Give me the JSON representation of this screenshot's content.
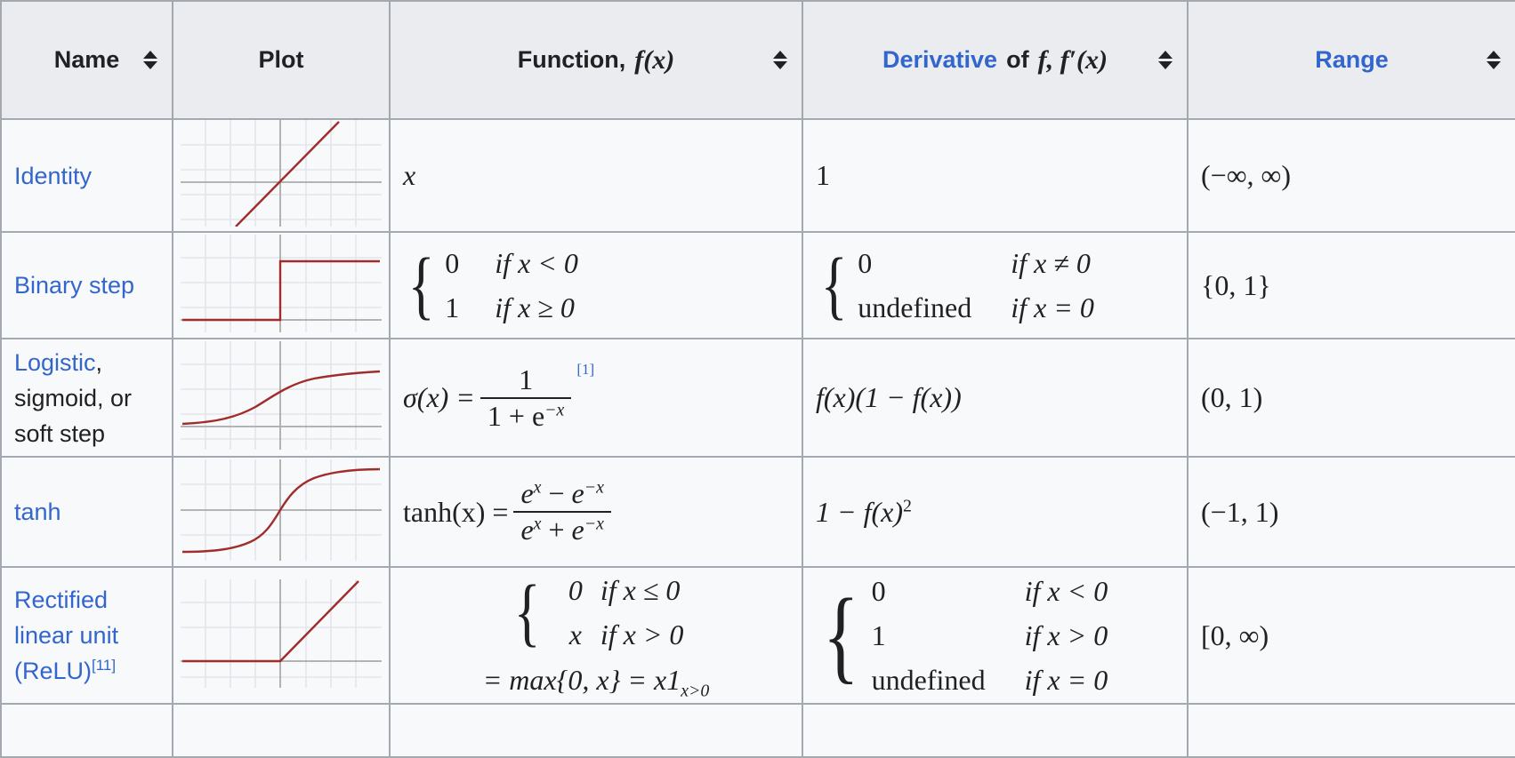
{
  "table": {
    "columns": [
      {
        "key": "name",
        "label": "Name",
        "sortable": true,
        "link": false
      },
      {
        "key": "plot",
        "label": "Plot",
        "sortable": false,
        "link": false
      },
      {
        "key": "function",
        "label": "Function, f(x)",
        "label_plain": "Function,",
        "label_math": "f(x)",
        "sortable": true,
        "link": false
      },
      {
        "key": "derivative",
        "label": "Derivative of f, f′(x)",
        "label_link": "Derivative",
        "label_plain": "of",
        "label_math": "f, f′(x)",
        "sortable": true,
        "link": true
      },
      {
        "key": "range",
        "label": "Range",
        "sortable": true,
        "link": true
      }
    ],
    "sort_icon": "sort-updown-icon",
    "rows": [
      {
        "name_parts": [
          {
            "text": "Identity",
            "link": true
          }
        ],
        "plot": "identity-plot",
        "function": {
          "kind": "simple",
          "text": "x"
        },
        "derivative": {
          "kind": "simple",
          "text": "1"
        },
        "range": "(−∞, ∞)"
      },
      {
        "name_parts": [
          {
            "text": "Binary step",
            "link": true
          }
        ],
        "plot": "binary-step-plot",
        "function": {
          "kind": "cases",
          "rows": [
            {
              "value": "0",
              "cond": "if x < 0"
            },
            {
              "value": "1",
              "cond": "if x ≥ 0"
            }
          ]
        },
        "derivative": {
          "kind": "cases",
          "rows": [
            {
              "value": "0",
              "cond": "if x ≠ 0"
            },
            {
              "value": "undefined",
              "cond": "if x = 0"
            }
          ]
        },
        "range": "{0, 1}"
      },
      {
        "name_parts": [
          {
            "text": "Logistic",
            "link": true
          },
          {
            "text": ", sigmoid, or soft step",
            "link": false
          }
        ],
        "name_lines": [
          "Logistic,",
          "sigmoid, or",
          "soft step"
        ],
        "plot": "logistic-plot",
        "function": {
          "kind": "sigmoid",
          "lhs": "σ(x) =",
          "num": "1",
          "den": "1 + e",
          "den_exp": "−x",
          "ref": "[1]"
        },
        "derivative": {
          "kind": "simple",
          "text": "f(x)(1 − f(x))"
        },
        "range": "(0, 1)"
      },
      {
        "name_parts": [
          {
            "text": "tanh",
            "link": true
          }
        ],
        "plot": "tanh-plot",
        "function": {
          "kind": "tanh",
          "lhs": "tanh(x) =",
          "num_a": "e",
          "num_a_exp": "x",
          "num_op": "−",
          "num_b": "e",
          "num_b_exp": "−x",
          "den_a": "e",
          "den_a_exp": "x",
          "den_op": "+",
          "den_b": "e",
          "den_b_exp": "−x"
        },
        "derivative": {
          "kind": "power",
          "base": "1 − f(x)",
          "exp": "2"
        },
        "range": "(−1, 1)"
      },
      {
        "name_parts": [
          {
            "text": "Rectified linear unit (ReLU)",
            "link": true
          },
          {
            "text": "[11]",
            "link": true,
            "ref": true
          }
        ],
        "name_lines": [
          "Rectified",
          "linear unit",
          "(ReLU)"
        ],
        "name_ref": "[11]",
        "plot": "relu-plot",
        "function": {
          "kind": "cases_plus",
          "rows": [
            {
              "value": "0",
              "cond": "if x ≤ 0"
            },
            {
              "value": "x",
              "cond": "if x > 0"
            }
          ],
          "extra": "= max{0, x} = x1",
          "extra_sub": "x>0"
        },
        "derivative": {
          "kind": "cases",
          "rows": [
            {
              "value": "0",
              "cond": "if x < 0"
            },
            {
              "value": "1",
              "cond": "if x > 0"
            },
            {
              "value": "undefined",
              "cond": "if x = 0"
            }
          ]
        },
        "range": "[0, ∞)"
      }
    ]
  },
  "colors": {
    "link": "#3366cc",
    "text": "#202122",
    "header_bg": "#eaecf0",
    "cell_bg": "#f8f9fa",
    "border": "#a2a9b1",
    "curve": "#a02c2c",
    "grid": "#e4e4ec",
    "axis": "#aaaaaa"
  },
  "chart_data": [
    {
      "type": "line",
      "name": "identity-plot",
      "title": "Identity",
      "xlim": [
        -4,
        4
      ],
      "ylim": [
        -2.6,
        2.6
      ],
      "x": [
        -2.4,
        -1.6,
        -0.8,
        0,
        0.8,
        1.6,
        2.4
      ],
      "y": [
        -2.4,
        -1.6,
        -0.8,
        0,
        0.8,
        1.6,
        2.4
      ],
      "grid": true,
      "axes": "center",
      "legend": "none"
    },
    {
      "type": "line",
      "name": "binary-step-plot",
      "title": "Binary step",
      "xlim": [
        -4,
        4
      ],
      "ylim": [
        -0.35,
        1.6
      ],
      "x": [
        -4,
        -0.02,
        0,
        4
      ],
      "y": [
        0,
        0,
        1,
        1
      ],
      "grid": true,
      "axes": "bottom",
      "legend": "none"
    },
    {
      "type": "line",
      "name": "logistic-plot",
      "title": "Logistic / sigmoid",
      "xlim": [
        -6,
        6
      ],
      "ylim": [
        -0.2,
        1.35
      ],
      "x": [
        -6,
        -4,
        -2,
        -1,
        0,
        1,
        2,
        4,
        6
      ],
      "y": [
        0.0025,
        0.018,
        0.119,
        0.269,
        0.5,
        0.731,
        0.881,
        0.982,
        0.998
      ],
      "grid": true,
      "axes": "bottom",
      "legend": "none"
    },
    {
      "type": "line",
      "name": "tanh-plot",
      "title": "tanh",
      "xlim": [
        -4,
        4
      ],
      "ylim": [
        -1.5,
        1.5
      ],
      "x": [
        -4,
        -3,
        -2,
        -1,
        0,
        1,
        2,
        3,
        4
      ],
      "y": [
        -0.999,
        -0.995,
        -0.964,
        -0.762,
        0,
        0.762,
        0.964,
        0.995,
        0.999
      ],
      "grid": true,
      "axes": "center",
      "legend": "none"
    },
    {
      "type": "line",
      "name": "relu-plot",
      "title": "Rectified linear unit (ReLU)",
      "xlim": [
        -4,
        4
      ],
      "ylim": [
        -0.5,
        2.8
      ],
      "x": [
        -4,
        0,
        2.6
      ],
      "y": [
        0,
        0,
        2.6
      ],
      "grid": true,
      "axes": "bottom",
      "legend": "none"
    }
  ]
}
